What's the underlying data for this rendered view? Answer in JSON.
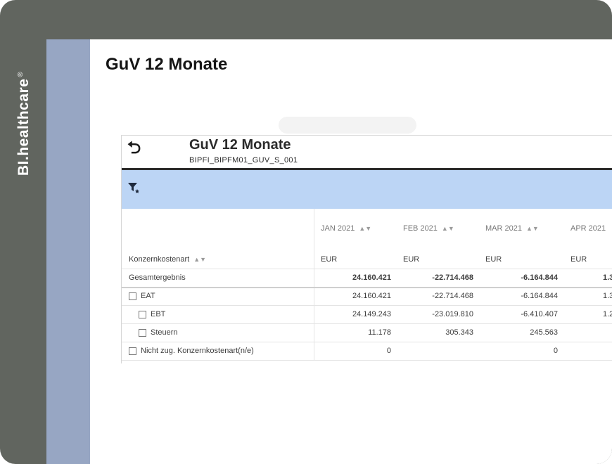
{
  "brand": {
    "name": "BI.healthcare",
    "mark": "®"
  },
  "page": {
    "title": "GuV 12 Monate"
  },
  "report": {
    "title": "GuV 12 Monate",
    "subtitle": "BIPFI_BIPFM01_GUV_S_001",
    "row_header": "Konzernkostenart",
    "columns": [
      {
        "month": "JAN 2021",
        "unit": "EUR"
      },
      {
        "month": "FEB 2021",
        "unit": "EUR"
      },
      {
        "month": "MAR 2021",
        "unit": "EUR"
      },
      {
        "month": "APR 2021",
        "unit": "EUR"
      }
    ],
    "rows": [
      {
        "label": "Gesamtergebnis",
        "values": [
          "24.160.421",
          "-22.714.468",
          "-6.164.844",
          "1.3"
        ]
      },
      {
        "label": "EAT",
        "values": [
          "24.160.421",
          "-22.714.468",
          "-6.164.844",
          "1.3"
        ]
      },
      {
        "label": "EBT",
        "values": [
          "24.149.243",
          "-23.019.810",
          "-6.410.407",
          "1.2"
        ]
      },
      {
        "label": "Steuern",
        "values": [
          "11.178",
          "305.343",
          "245.563",
          ""
        ]
      },
      {
        "label": "Nicht zug. Konzernkostenart(n/e)",
        "values": [
          "0",
          "",
          "0",
          ""
        ]
      }
    ]
  }
}
